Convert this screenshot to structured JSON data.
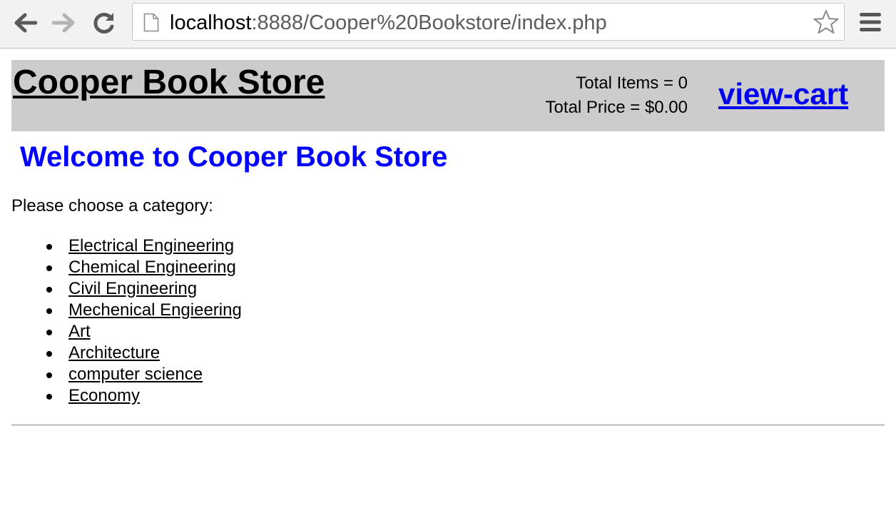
{
  "browser": {
    "url_host": "localhost",
    "url_rest": ":8888/Cooper%20Bookstore/index.php",
    "icons": {
      "back": "back-arrow-icon",
      "forward": "forward-arrow-icon",
      "reload": "reload-icon",
      "page": "page-icon",
      "star": "star-icon",
      "menu": "menu-icon"
    }
  },
  "header": {
    "store_title": "Cooper Book Store",
    "total_items": "Total Items = 0",
    "total_price": "Total Price = $0.00",
    "view_cart": "view-cart",
    "background": "#cccccc"
  },
  "main": {
    "welcome": "Welcome to Cooper Book Store",
    "welcome_color": "#0000ff",
    "prompt": "Please choose a category:",
    "categories": [
      "Electrical Engineering",
      "Chemical Engineering",
      "Civil Engineering",
      "Mechenical Engieering",
      "Art",
      "Architecture",
      "computer science",
      "Economy"
    ]
  }
}
